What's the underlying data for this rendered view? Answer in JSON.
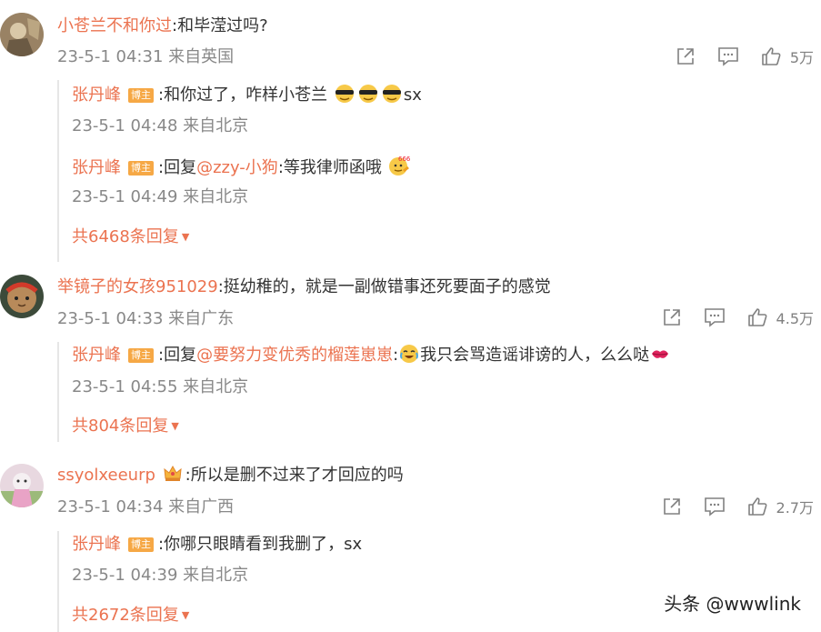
{
  "comments": [
    {
      "username": "小苍兰不和你过",
      "text": ":和毕滢过吗?",
      "meta": "23-5-1 04:31 来自英国",
      "likes": "5万",
      "replies": [
        {
          "username": "张丹峰",
          "badge": "博主",
          "text": ":和你过了，咋样小苍兰",
          "suffix": "sx",
          "emoji": "cool-face-emoji"
        },
        {
          "meta": "23-5-1 04:48 来自北京"
        },
        {
          "username": "张丹峰",
          "badge": "博主",
          "prefix": ":回复",
          "mention": "@zzy-小狗",
          "text": ":等我律师函哦",
          "emoji": "666-face-emoji"
        },
        {
          "meta": "23-5-1 04:49 来自北京"
        }
      ],
      "more": "共6468条回复"
    },
    {
      "username": "举镜子的女孩951029",
      "text": ":挺幼稚的，就是一副做错事还死要面子的感觉",
      "meta": "23-5-1 04:33 来自广东",
      "likes": "4.5万",
      "reply": {
        "username": "张丹峰",
        "badge": "博主",
        "prefix": ":回复",
        "mention": "@要努力变优秀的榴莲崽崽",
        "text": "我只会骂造谣诽谤的人，么么哒",
        "meta": "23-5-1 04:55 来自北京"
      },
      "more": "共804条回复"
    },
    {
      "username": "ssyolxeeurp",
      "text": ":所以是删不过来了才回应的吗",
      "meta": "23-5-1 04:34 来自广西",
      "likes": "2.7万",
      "reply": {
        "username": "张丹峰",
        "badge": "博主",
        "text": ":你哪只眼睛看到我删了，sx",
        "meta": "23-5-1 04:39 来自北京"
      },
      "more": "共2672条回复"
    }
  ],
  "watermark": "头条 @wwwlink",
  "colors": {
    "accent": "#eb7350",
    "badge": "#f6a845",
    "meta": "#888888"
  }
}
